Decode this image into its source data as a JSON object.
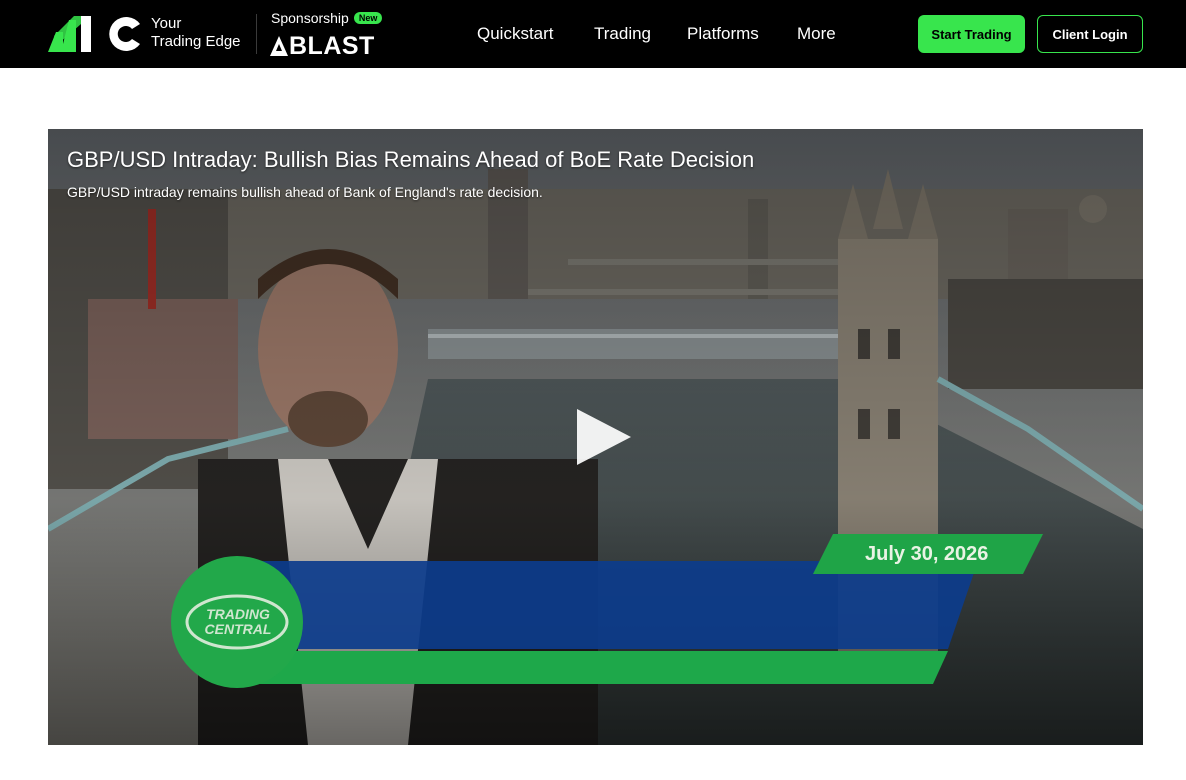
{
  "header": {
    "logo_text": "HC",
    "tagline_line1": "Your",
    "tagline_line2": "Trading Edge",
    "sponsorship_label": "Sponsorship",
    "new_badge": "New",
    "sponsor_name": "BLAST",
    "nav": [
      {
        "label": "Quickstart"
      },
      {
        "label": "Trading"
      },
      {
        "label": "Platforms"
      },
      {
        "label": "More"
      }
    ],
    "start_trading_label": "Start Trading",
    "client_login_label": "Client Login",
    "accent_color": "#38e54d"
  },
  "video": {
    "title": "GBP/USD Intraday: Bullish Bias Remains Ahead of BoE Rate Decision",
    "subtitle": "GBP/USD intraday remains bullish ahead of Bank of England's rate decision.",
    "date": "July 30, 2026",
    "brand_line1": "TRADING",
    "brand_line2": "CENTRAL",
    "play_icon": "play-icon"
  }
}
